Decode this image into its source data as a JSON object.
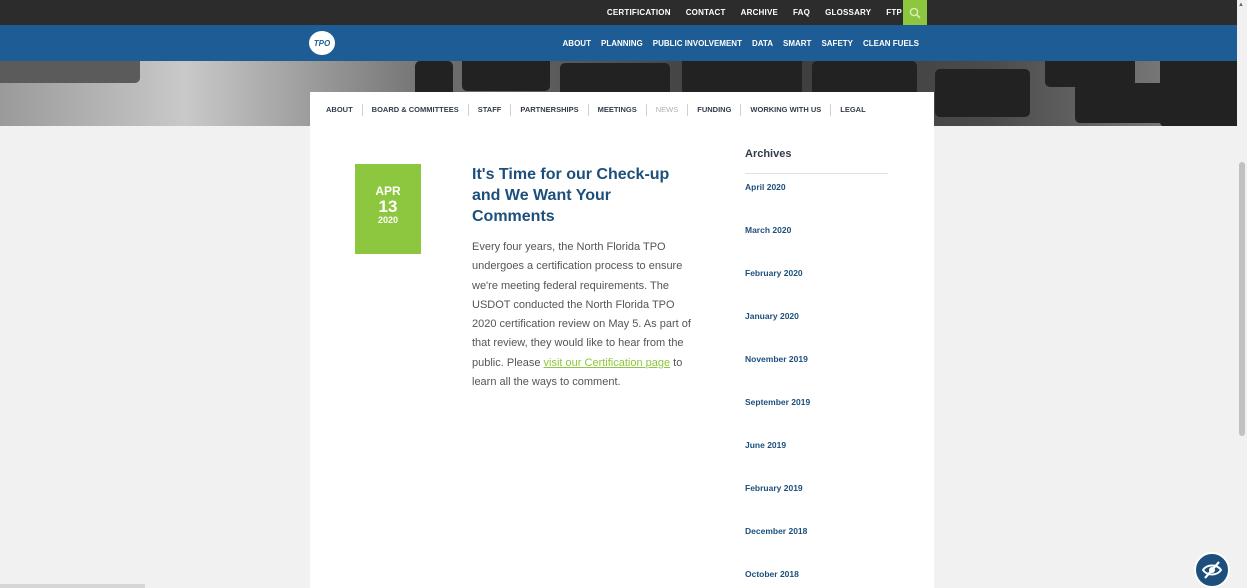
{
  "topbar": {
    "links": [
      "CERTIFICATION",
      "CONTACT",
      "ARCHIVE",
      "FAQ",
      "GLOSSARY",
      "FTP"
    ]
  },
  "mainbar": {
    "logo_text": "TPO",
    "links": [
      "ABOUT",
      "PLANNING",
      "PUBLIC INVOLVEMENT",
      "DATA",
      "SMART",
      "SAFETY",
      "CLEAN FUELS"
    ]
  },
  "subnav": {
    "links": [
      "ABOUT",
      "BOARD & COMMITTEES",
      "STAFF",
      "PARTNERSHIPS",
      "MEETINGS",
      "NEWS",
      "FUNDING",
      "WORKING WITH US",
      "LEGAL"
    ]
  },
  "post": {
    "date": {
      "month": "APR",
      "day": "13",
      "year": "2020"
    },
    "title": "It's Time for our Check-up and We Want Your Comments",
    "body_before_link": "Every four years, the North Florida TPO undergoes a certification process to ensure we're meeting federal requirements. The USDOT conducted the North Florida TPO 2020 certification review on May 5. As part of that review, they would like to hear from the public. Please ",
    "link_text": "visit our Certification page",
    "body_after_link": " to learn all the ways to comment."
  },
  "archives": {
    "title": "Archives",
    "items": [
      "April 2020",
      "March 2020",
      "February 2020",
      "January 2020",
      "November 2019",
      "September 2019",
      "June 2019",
      "February 2019",
      "December 2018",
      "October 2018"
    ]
  },
  "colors": {
    "topbar": "#2c2c2c",
    "mainbar": "#1d5c94",
    "accent_green": "#8dc63f",
    "title_blue": "#1d4f7c"
  },
  "icons": {
    "search": "search-icon",
    "accessibility": "accessibility-eye-icon"
  }
}
